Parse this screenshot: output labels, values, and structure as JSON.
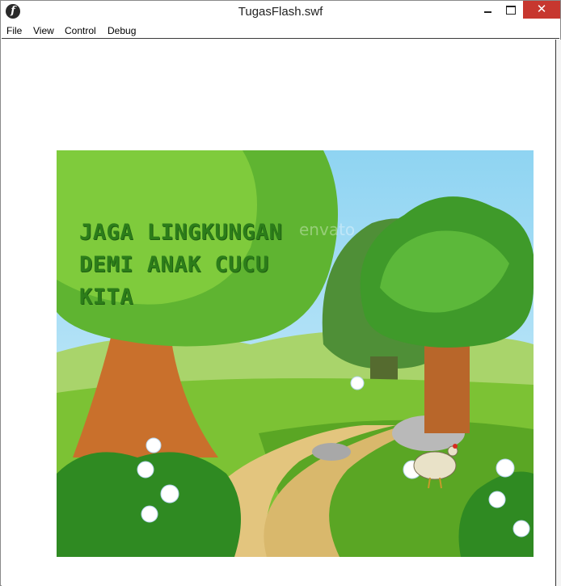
{
  "window": {
    "title": "TugasFlash.swf",
    "close_glyph": "✕"
  },
  "menu": {
    "items": [
      "File",
      "View",
      "Control",
      "Debug"
    ]
  },
  "stage": {
    "headline_lines": [
      "JAGA LINGKUNGAN",
      "DEMI ANAK CUCU",
      "KITA"
    ],
    "headline_color": "#2c7d1a",
    "watermark": "envato"
  },
  "icons": {
    "app": "flash-player-icon",
    "minimize": "minimize-icon",
    "maximize": "maximize-icon",
    "close": "close-icon"
  }
}
